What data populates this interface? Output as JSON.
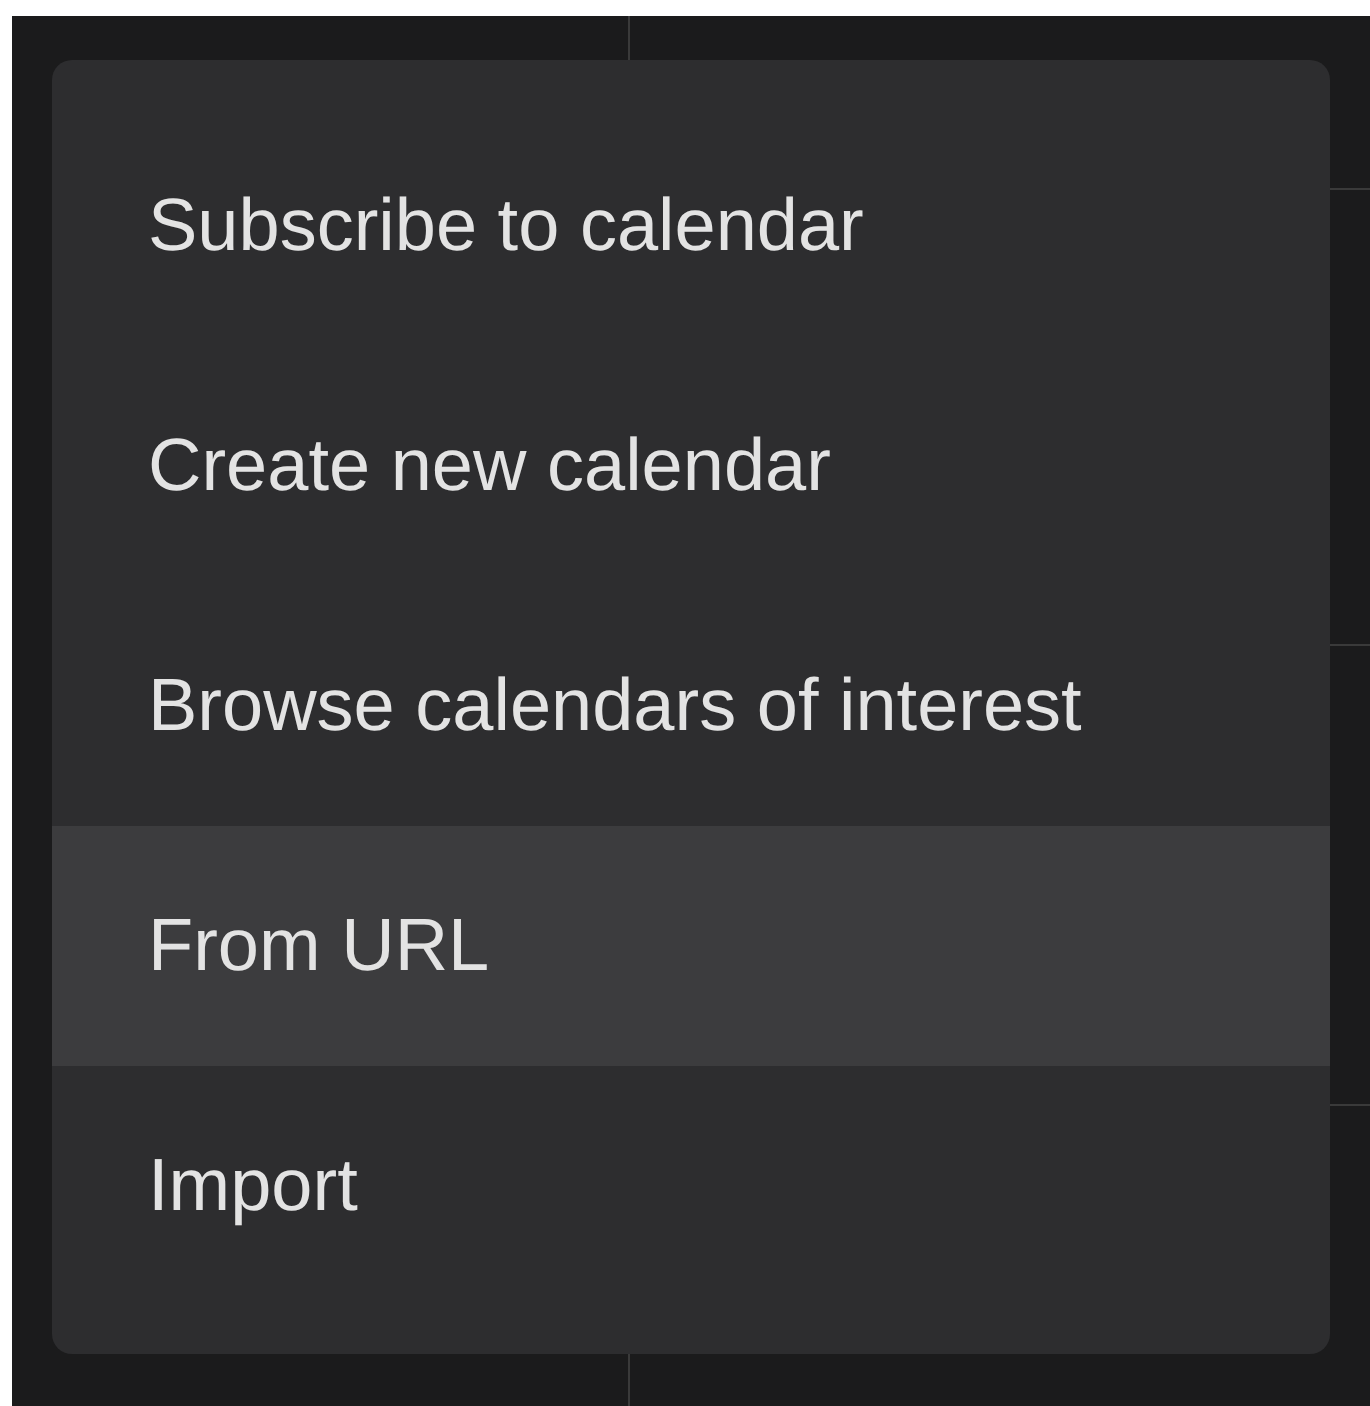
{
  "menu": {
    "items": [
      {
        "label": "Subscribe to calendar",
        "highlighted": false
      },
      {
        "label": "Create new calendar",
        "highlighted": false
      },
      {
        "label": "Browse calendars of interest",
        "highlighted": false
      },
      {
        "label": "From URL",
        "highlighted": true
      },
      {
        "label": "Import",
        "highlighted": false
      }
    ]
  }
}
